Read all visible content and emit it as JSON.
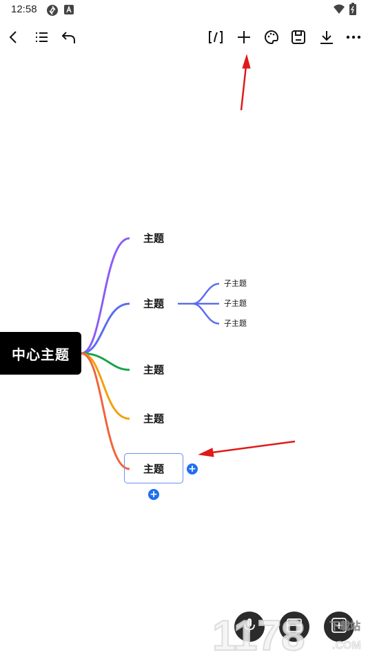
{
  "status_bar": {
    "time": "12:58"
  },
  "toolbar": {
    "left_icons": [
      "back-icon",
      "outline-icon",
      "undo-icon"
    ],
    "right_icons": [
      "link-icon",
      "add-icon",
      "palette-icon",
      "save-icon",
      "download-icon",
      "more-icon"
    ]
  },
  "mindmap": {
    "center": "中心主题",
    "topics": [
      {
        "label": "主题",
        "color": "#8b5cf6"
      },
      {
        "label": "主题",
        "color": "#5b6cf0"
      },
      {
        "label": "主题",
        "color": "#16a34a"
      },
      {
        "label": "主题",
        "color": "#f59e0b"
      },
      {
        "label": "主题",
        "color": "#f0643a"
      }
    ],
    "subtopics": [
      "子主题",
      "子主题",
      "子主题"
    ]
  },
  "bottom": {
    "fab_icons": [
      "mic-icon",
      "layout-icon",
      "add-node-icon"
    ]
  },
  "watermark": {
    "brand": "1178",
    "site_a": "下载站",
    "site_b": ".COM"
  },
  "annotation_color": "#e01919"
}
